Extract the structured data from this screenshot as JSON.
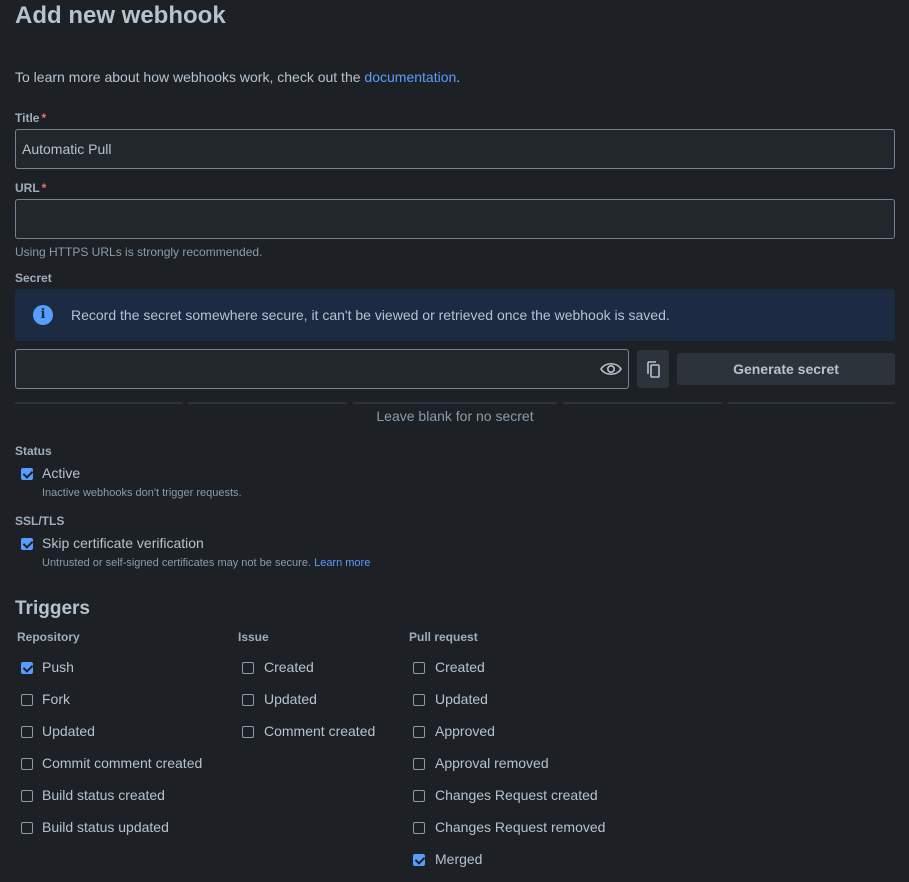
{
  "page": {
    "title": "Add new webhook",
    "intro_text": "To learn more about how webhooks work, check out the ",
    "intro_link": "documentation",
    "intro_end": "."
  },
  "form": {
    "title_label": "Title",
    "title_value": "Automatic Pull",
    "url_label": "URL",
    "url_value": "",
    "url_help": "Using HTTPS URLs is strongly recommended.",
    "required_mark": "*",
    "secret_label": "Secret",
    "secret_info": "Record the secret somewhere secure, it can't be viewed or retrieved once the webhook is saved.",
    "secret_value": "",
    "generate_secret": "Generate secret",
    "secret_help": "Leave blank for no secret",
    "status_label": "Status",
    "active_label": "Active",
    "active_checked": true,
    "active_help": "Inactive webhooks don't trigger requests.",
    "ssl_label": "SSL/TLS",
    "skip_cert_label": "Skip certificate verification",
    "skip_cert_checked": true,
    "skip_cert_help": "Untrusted or self-signed certificates may not be secure.",
    "learn_more": "Learn more"
  },
  "triggers": {
    "title": "Triggers",
    "repository": {
      "heading": "Repository",
      "items": [
        {
          "label": "Push",
          "checked": true
        },
        {
          "label": "Fork",
          "checked": false
        },
        {
          "label": "Updated",
          "checked": false
        },
        {
          "label": "Commit comment created",
          "checked": false
        },
        {
          "label": "Build status created",
          "checked": false
        },
        {
          "label": "Build status updated",
          "checked": false
        }
      ]
    },
    "issue": {
      "heading": "Issue",
      "items": [
        {
          "label": "Created",
          "checked": false
        },
        {
          "label": "Updated",
          "checked": false
        },
        {
          "label": "Comment created",
          "checked": false
        }
      ]
    },
    "pull_request": {
      "heading": "Pull request",
      "items": [
        {
          "label": "Created",
          "checked": false
        },
        {
          "label": "Updated",
          "checked": false
        },
        {
          "label": "Approved",
          "checked": false
        },
        {
          "label": "Approval removed",
          "checked": false
        },
        {
          "label": "Changes Request created",
          "checked": false
        },
        {
          "label": "Changes Request removed",
          "checked": false
        },
        {
          "label": "Merged",
          "checked": true
        }
      ]
    }
  },
  "icons": {
    "info": "info-icon",
    "eye": "eye-icon",
    "copy": "copy-icon"
  },
  "colors": {
    "background": "#1d2125",
    "accent": "#579dff",
    "required": "#f87168"
  }
}
